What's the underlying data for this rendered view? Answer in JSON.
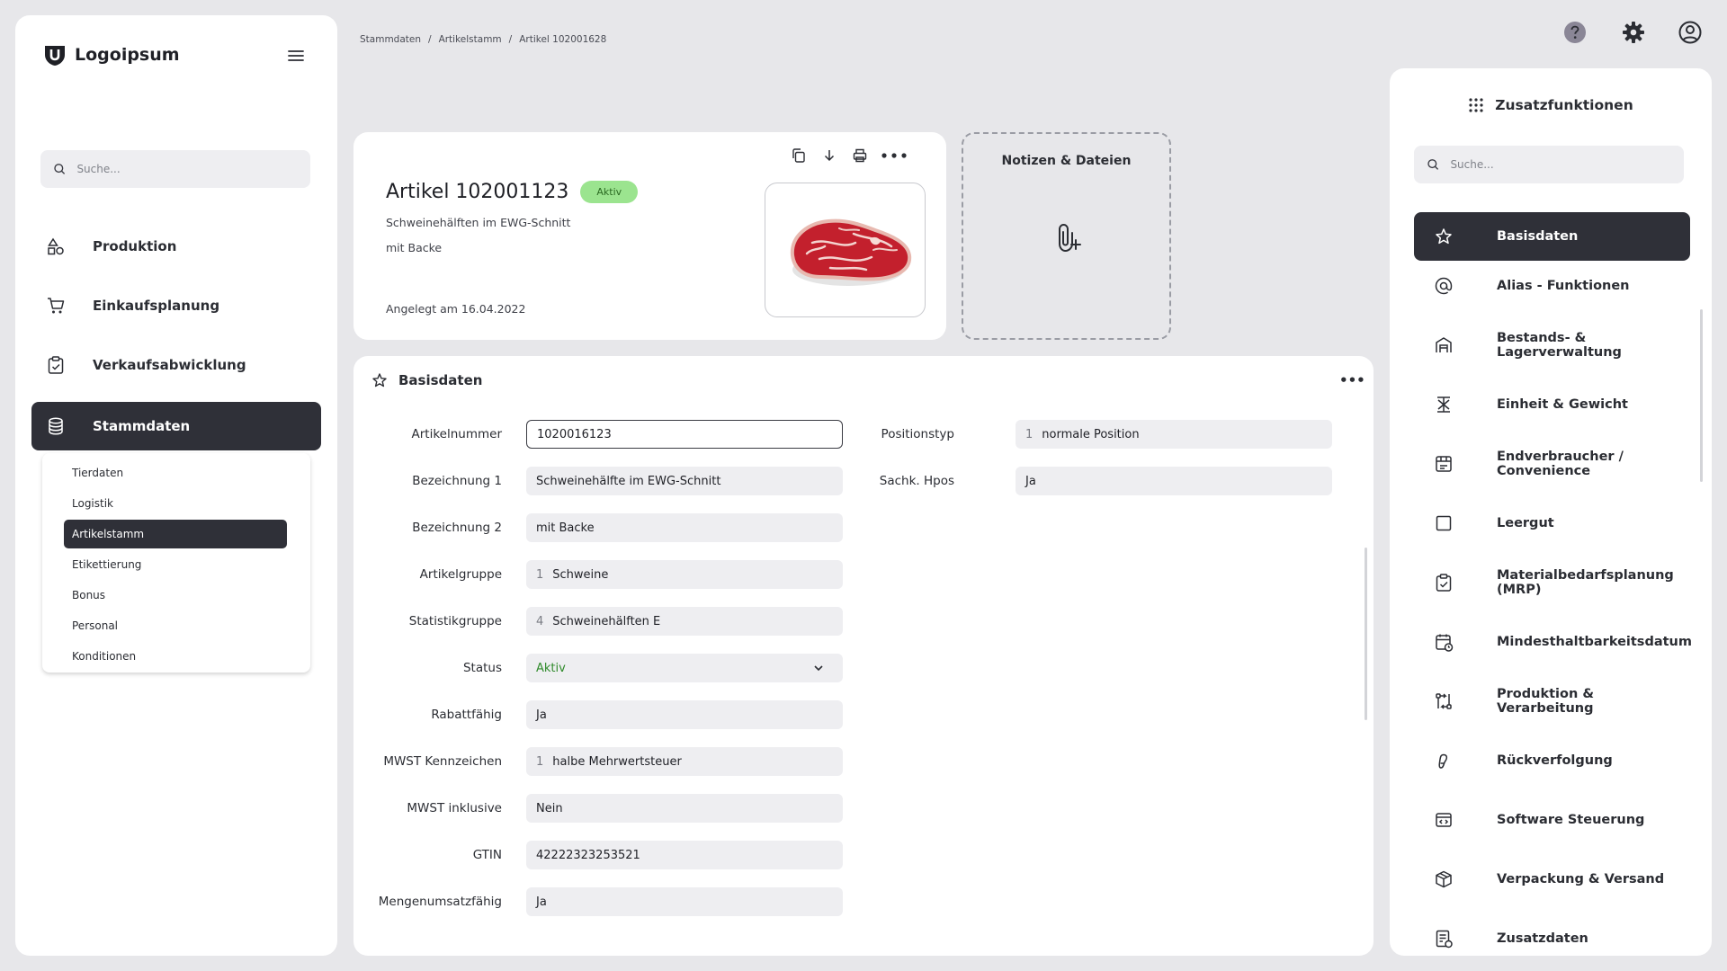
{
  "brand": {
    "name": "Logoipsum"
  },
  "sidebar": {
    "search_placeholder": "Suche...",
    "nav": [
      {
        "label": "Produktion",
        "icon": "shapes-icon"
      },
      {
        "label": "Einkaufsplanung",
        "icon": "cart-icon"
      },
      {
        "label": "Verkaufsabwicklung",
        "icon": "clipboard-check-icon"
      },
      {
        "label": "Stammdaten",
        "icon": "database-icon"
      }
    ],
    "submenu": [
      "Tierdaten",
      "Logistik",
      "Artikelstamm",
      "Etikettierung",
      "Bonus",
      "Personal",
      "Konditionen"
    ]
  },
  "breadcrumb": [
    "Stammdaten",
    "Artikelstamm",
    "Artikel 102001628"
  ],
  "breadcrumb_separator": "/",
  "article": {
    "title": "Artikel 102001123",
    "status_badge": "Aktiv",
    "line1": "Schweinehälften im EWG-Schnitt",
    "line2": "mit Backe",
    "created": "Angelegt am 16.04.2022"
  },
  "notes": {
    "title": "Notizen & Dateien"
  },
  "form": {
    "title": "Basisdaten",
    "more": "•••",
    "left_fields": [
      {
        "label": "Artikelnummer",
        "value": "1020016123"
      },
      {
        "label": "Bezeichnung 1",
        "value": "Schweinehälfte im EWG-Schnitt"
      },
      {
        "label": "Bezeichnung 2",
        "value": "mit Backe"
      },
      {
        "label": "Artikelgruppe",
        "num": "1",
        "value": "Schweine"
      },
      {
        "label": "Statistikgruppe",
        "num": "4",
        "value": "Schweinehälften E"
      },
      {
        "label": "Status",
        "value": "Aktiv"
      },
      {
        "label": "Rabattfähig",
        "value": "Ja"
      },
      {
        "label": "MWST Kennzeichen",
        "num": "1",
        "value": "halbe Mehrwertsteuer"
      },
      {
        "label": "MWST inklusive",
        "value": "Nein"
      },
      {
        "label": "GTIN",
        "value": "42222323253521"
      },
      {
        "label": "Mengenumsatzfähig",
        "value": "Ja"
      }
    ],
    "right_fields": [
      {
        "label": "Positionstyp",
        "num": "1",
        "value": "normale Position"
      },
      {
        "label": "Sachk. Hpos",
        "value": "Ja"
      }
    ]
  },
  "extras": {
    "title": "Zusatzfunktionen",
    "search_placeholder": "Suche...",
    "items": [
      {
        "label": "Basisdaten",
        "icon": "star-icon"
      },
      {
        "label": "Alias - Funktionen",
        "icon": "at-icon"
      },
      {
        "label": "Bestands- & Lagerverwaltung",
        "icon": "warehouse-icon"
      },
      {
        "label": "Einheit & Gewicht",
        "icon": "scale-icon"
      },
      {
        "label": "Endverbraucher / Convenience",
        "icon": "store-icon"
      },
      {
        "label": "Leergut",
        "icon": "square-icon"
      },
      {
        "label": "Materialbedarfsplanung (MRP)",
        "icon": "clipboard-check-icon"
      },
      {
        "label": "Mindesthaltbarkeitsdatum",
        "icon": "calendar-clock-icon"
      },
      {
        "label": "Produktion & Verarbeitung",
        "icon": "workflow-icon"
      },
      {
        "label": "Rückverfolgung",
        "icon": "footprint-icon"
      },
      {
        "label": "Software Steuerung",
        "icon": "code-window-icon"
      },
      {
        "label": "Verpackung & Versand",
        "icon": "package-icon"
      },
      {
        "label": "Zusatzdaten",
        "icon": "document-icon"
      }
    ]
  }
}
